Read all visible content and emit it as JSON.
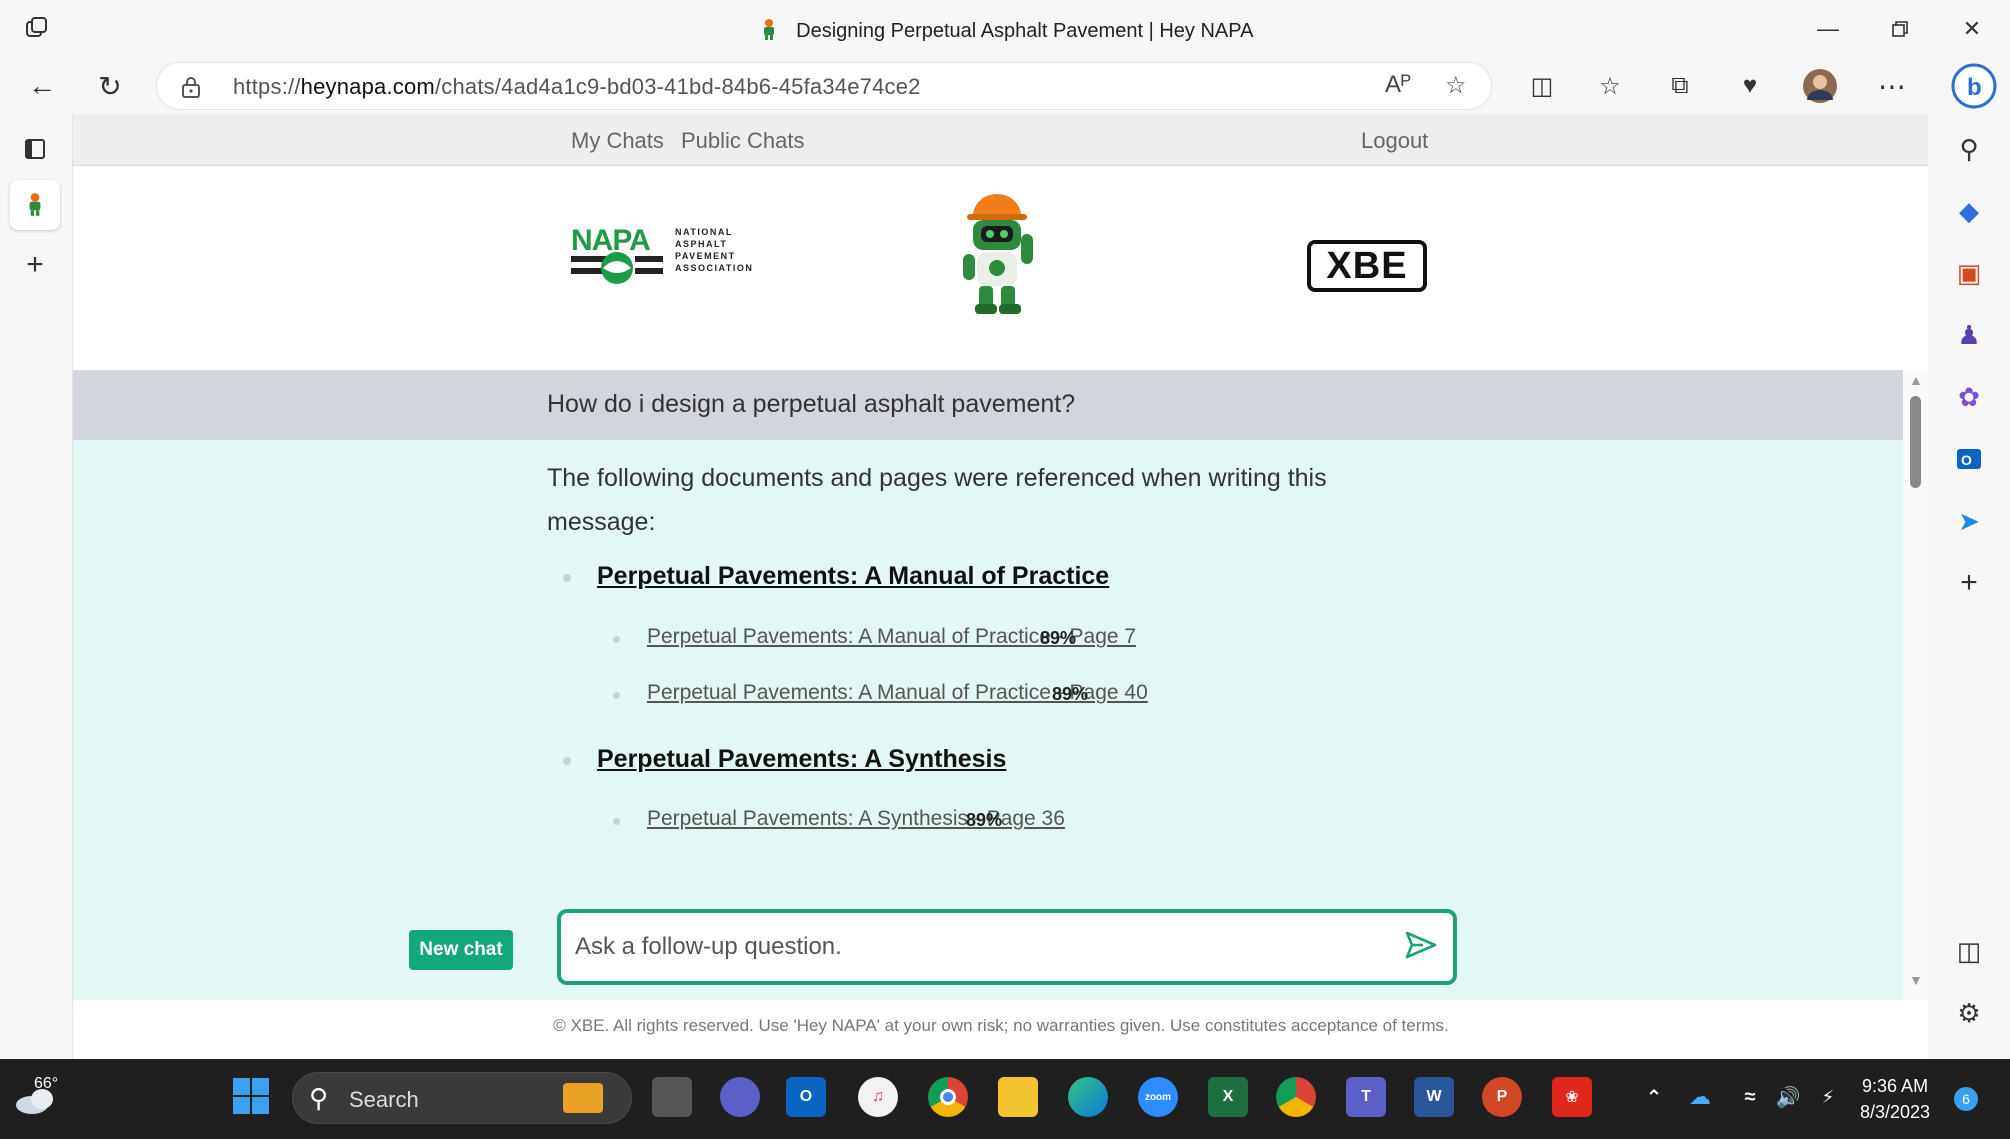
{
  "window": {
    "title": "Designing Perpetual Asphalt Pavement | Hey NAPA"
  },
  "browser": {
    "url_prefix": "https://",
    "url_domain": "heynapa.com",
    "url_path": "/chats/4ad4a1c9-bd03-41bd-84b6-45fa34e74ce2",
    "read_aloud_label": "Aᴾ"
  },
  "nav": {
    "my_chats": "My Chats",
    "public_chats": "Public Chats",
    "logout": "Logout"
  },
  "logos": {
    "napa_word": "NAPA",
    "napa_line1": "NATIONAL",
    "napa_line2": "ASPHALT",
    "napa_line3": "PAVEMENT",
    "napa_line4": "ASSOCIATION",
    "xbe": "XBE"
  },
  "chat": {
    "question": "How do i design a perpetual asphalt pavement?",
    "intro": "The following documents and pages were referenced when writing this message:",
    "documents": [
      {
        "title": "Perpetual Pavements: A Manual of Practice",
        "pages": [
          {
            "label": "Perpetual Pavements: A Manual of Practice - Page 7 ",
            "score": "89%"
          },
          {
            "label": "Perpetual Pavements: A Manual of Practice - Page 40 ",
            "score": "89%"
          }
        ]
      },
      {
        "title": "Perpetual Pavements: A Synthesis",
        "pages": [
          {
            "label": "Perpetual Pavements: A Synthesis - Page 36 ",
            "score": "89%"
          }
        ]
      }
    ]
  },
  "composer": {
    "new_chat": "New chat",
    "placeholder": "Ask a follow-up question."
  },
  "footer": "© XBE. All rights reserved. Use 'Hey NAPA' at your own risk; no warranties given. Use constitutes acceptance of terms.",
  "taskbar": {
    "temperature": "66°",
    "search_label": "Search",
    "time": "9:36 AM",
    "date": "8/3/2023",
    "notification_count": "6"
  },
  "colors": {
    "accent": "#13a87c",
    "question_bg": "#d2d5dc",
    "answer_bg": "#e3f8f4"
  }
}
